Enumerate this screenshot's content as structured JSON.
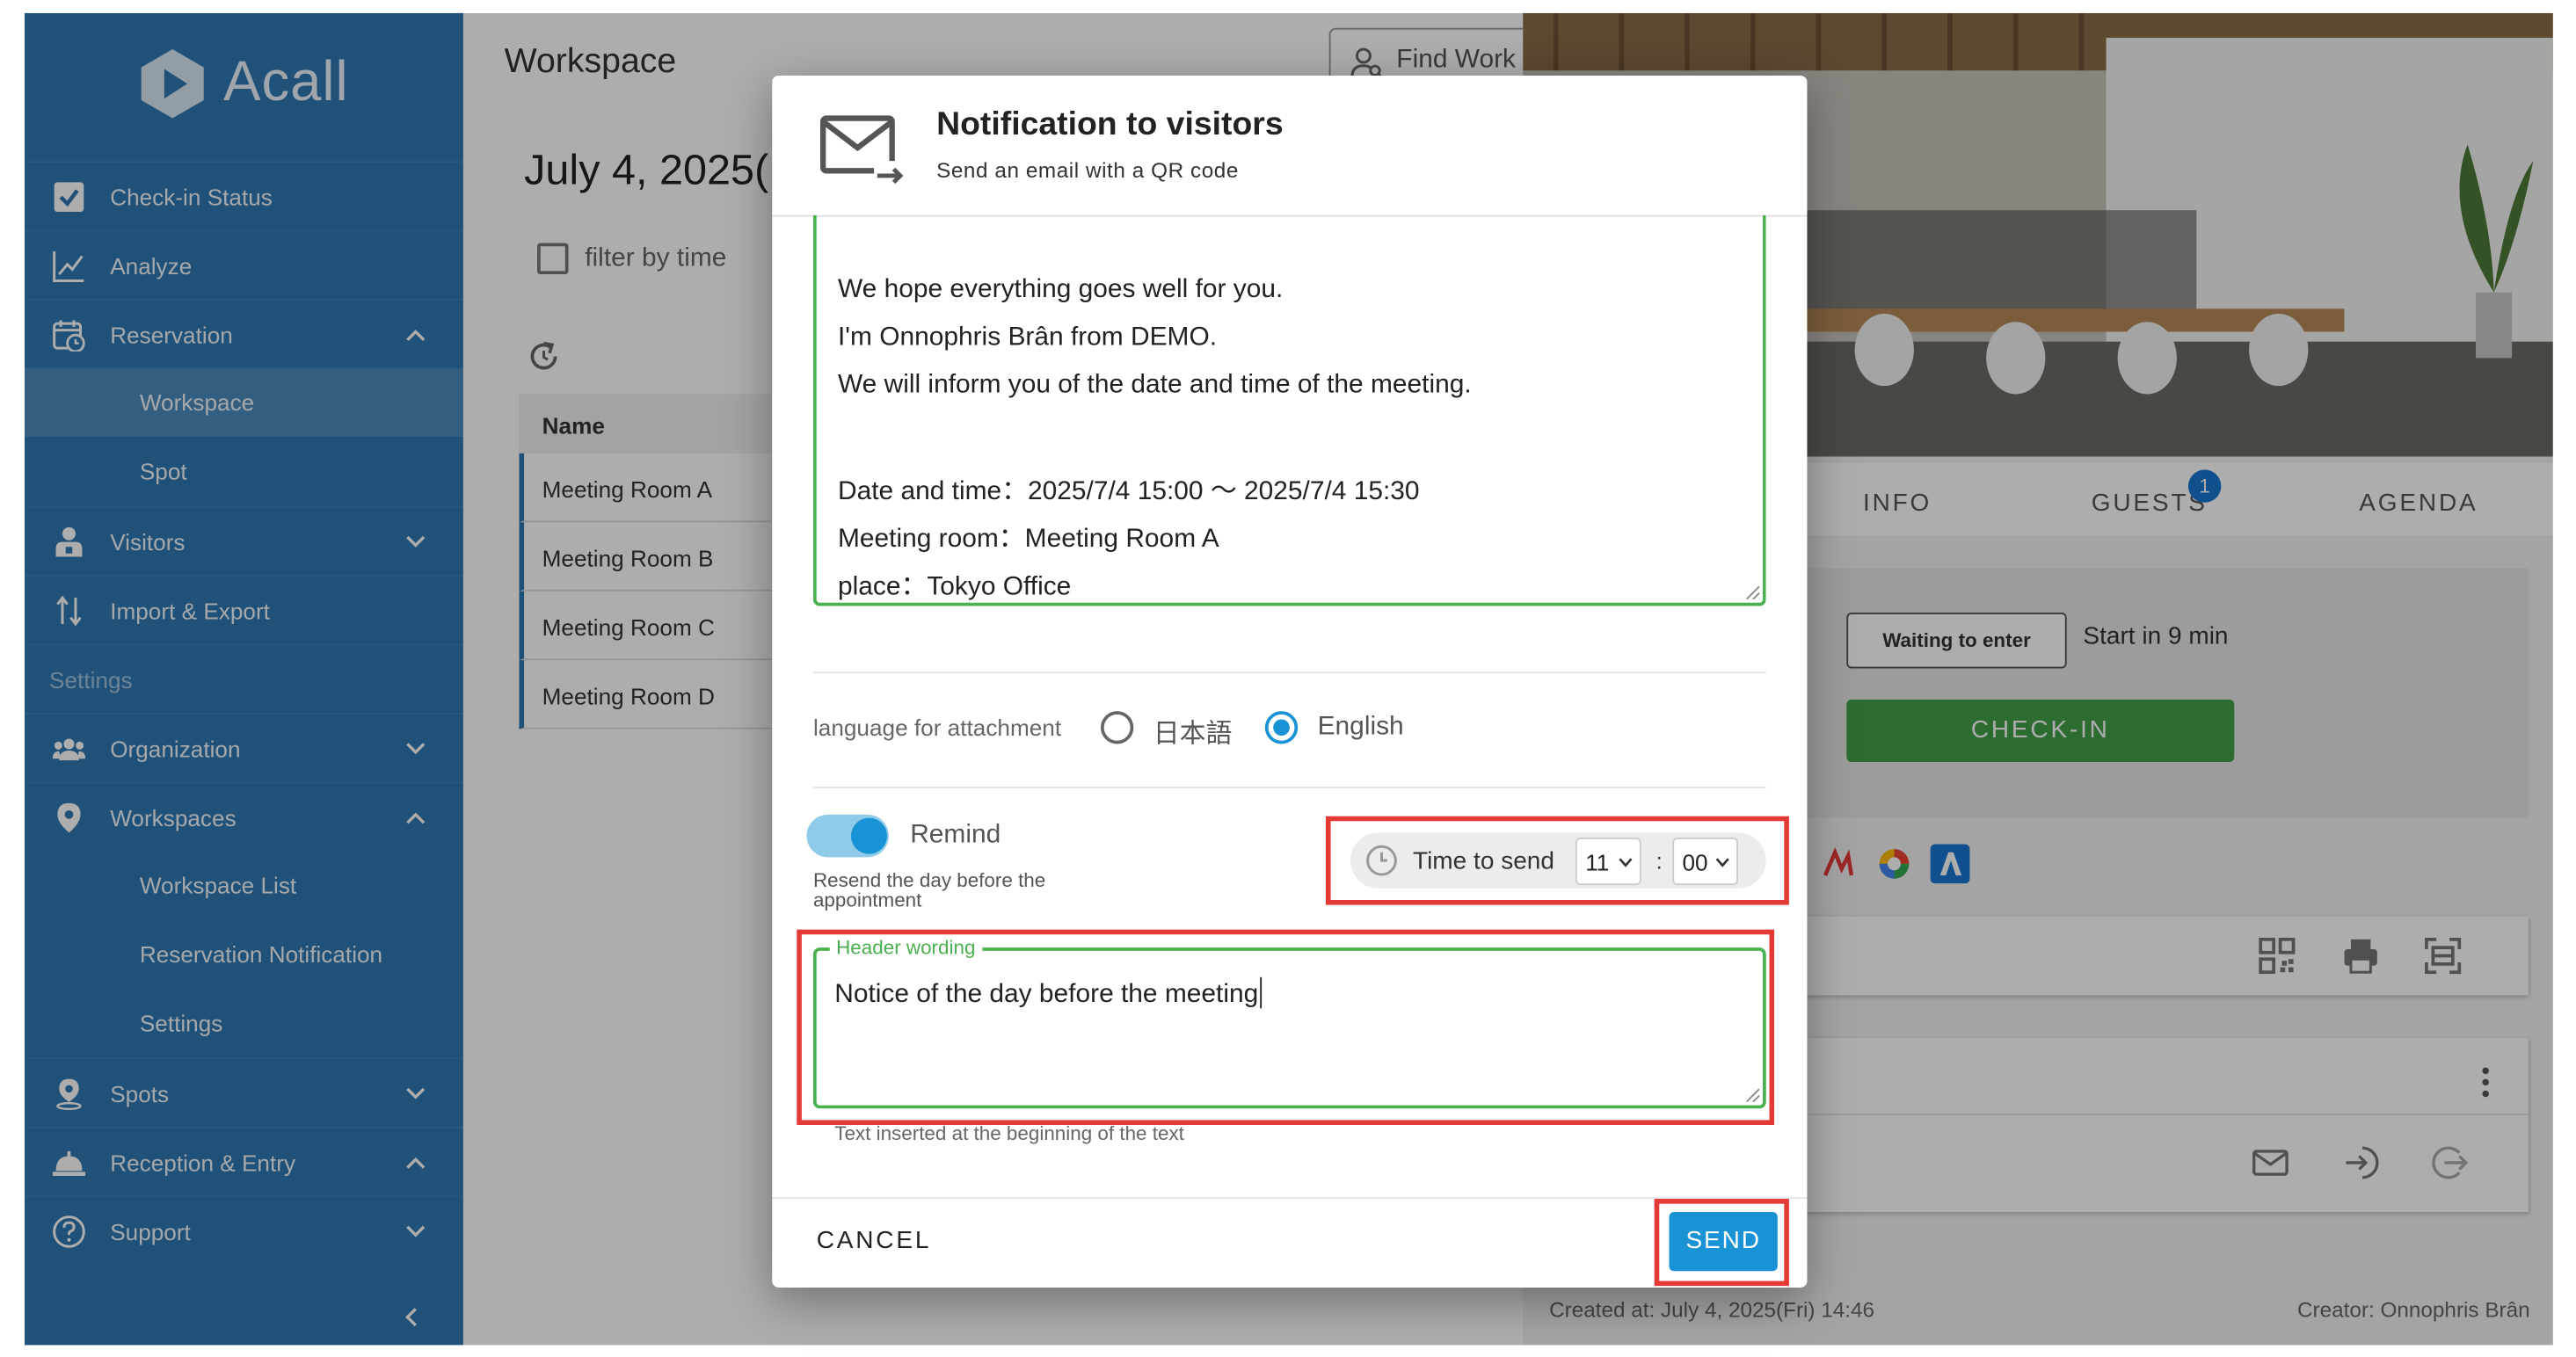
{
  "app": {
    "name": "Acall"
  },
  "sidebar": {
    "items": [
      {
        "label": "Check-in Status",
        "icon": "check-square-icon"
      },
      {
        "label": "Analyze",
        "icon": "chart-line-icon"
      },
      {
        "label": "Reservation",
        "icon": "calendar-clock-icon"
      },
      {
        "label": "Workspace"
      },
      {
        "label": "Spot"
      },
      {
        "label": "Visitors",
        "icon": "visitor-icon"
      },
      {
        "label": "Import & Export",
        "icon": "import-export-icon"
      }
    ],
    "settings_label": "Settings",
    "settings_items": [
      {
        "label": "Organization",
        "icon": "people-icon"
      },
      {
        "label": "Workspaces",
        "icon": "location-pin-icon"
      },
      {
        "label": "Workspace List"
      },
      {
        "label": "Reservation Notification"
      },
      {
        "label": "Settings"
      },
      {
        "label": "Spots",
        "icon": "spot-pin-icon"
      },
      {
        "label": "Reception & Entry",
        "icon": "reception-bell-icon"
      },
      {
        "label": "Support",
        "icon": "help-circle-icon"
      }
    ]
  },
  "main": {
    "title": "Workspace",
    "find_button": "Find Work",
    "date": "July 4, 2025(",
    "filter_label": "filter by time",
    "table_header": "Name",
    "rooms": [
      "Meeting Room A",
      "Meeting Room B",
      "Meeting Room C",
      "Meeting Room D"
    ]
  },
  "detail": {
    "tabs": [
      "INFO",
      "GUESTS",
      "AGENDA"
    ],
    "guests_badge": "1",
    "status_badge": "Waiting to enter",
    "start_in": "Start in 9 min",
    "checkin_button": "CHECK-IN",
    "created": "Created at: July 4, 2025(Fri) 14:46",
    "creator": "Creator: Onnophris Brân"
  },
  "modal": {
    "title": "Notification to visitors",
    "subtitle": "Send an email with a QR code",
    "body_lines": [
      "We hope everything goes well for you.",
      "I'm Onnophris Brân from DEMO.",
      "We will inform you of the date and time of the meeting.",
      "",
      "Date and time：2025/7/4 15:00 〜 2025/7/4 15:30",
      "Meeting room：Meeting Room A",
      "place：Tokyo Office"
    ],
    "language_label": "language for attachment",
    "languages": [
      "日本語",
      "English"
    ],
    "selected_language": "English",
    "remind_label": "Remind",
    "remind_on": true,
    "resend_note": "Resend the day before the appointment",
    "time_to_send_label": "Time to send",
    "hour": "11",
    "minute": "00",
    "colon": ":",
    "header_wording_label": "Header wording",
    "header_wording_value": "Notice of the day before the meeting",
    "header_help": "Text inserted at the beginning of the text",
    "cancel_label": "CANCEL",
    "send_label": "SEND"
  },
  "colors": {
    "sidebar": "#2f78b3",
    "primary": "#1a93d6",
    "field_focus": "#4caf50",
    "checkin": "#43a047",
    "highlight": "#e53935"
  }
}
